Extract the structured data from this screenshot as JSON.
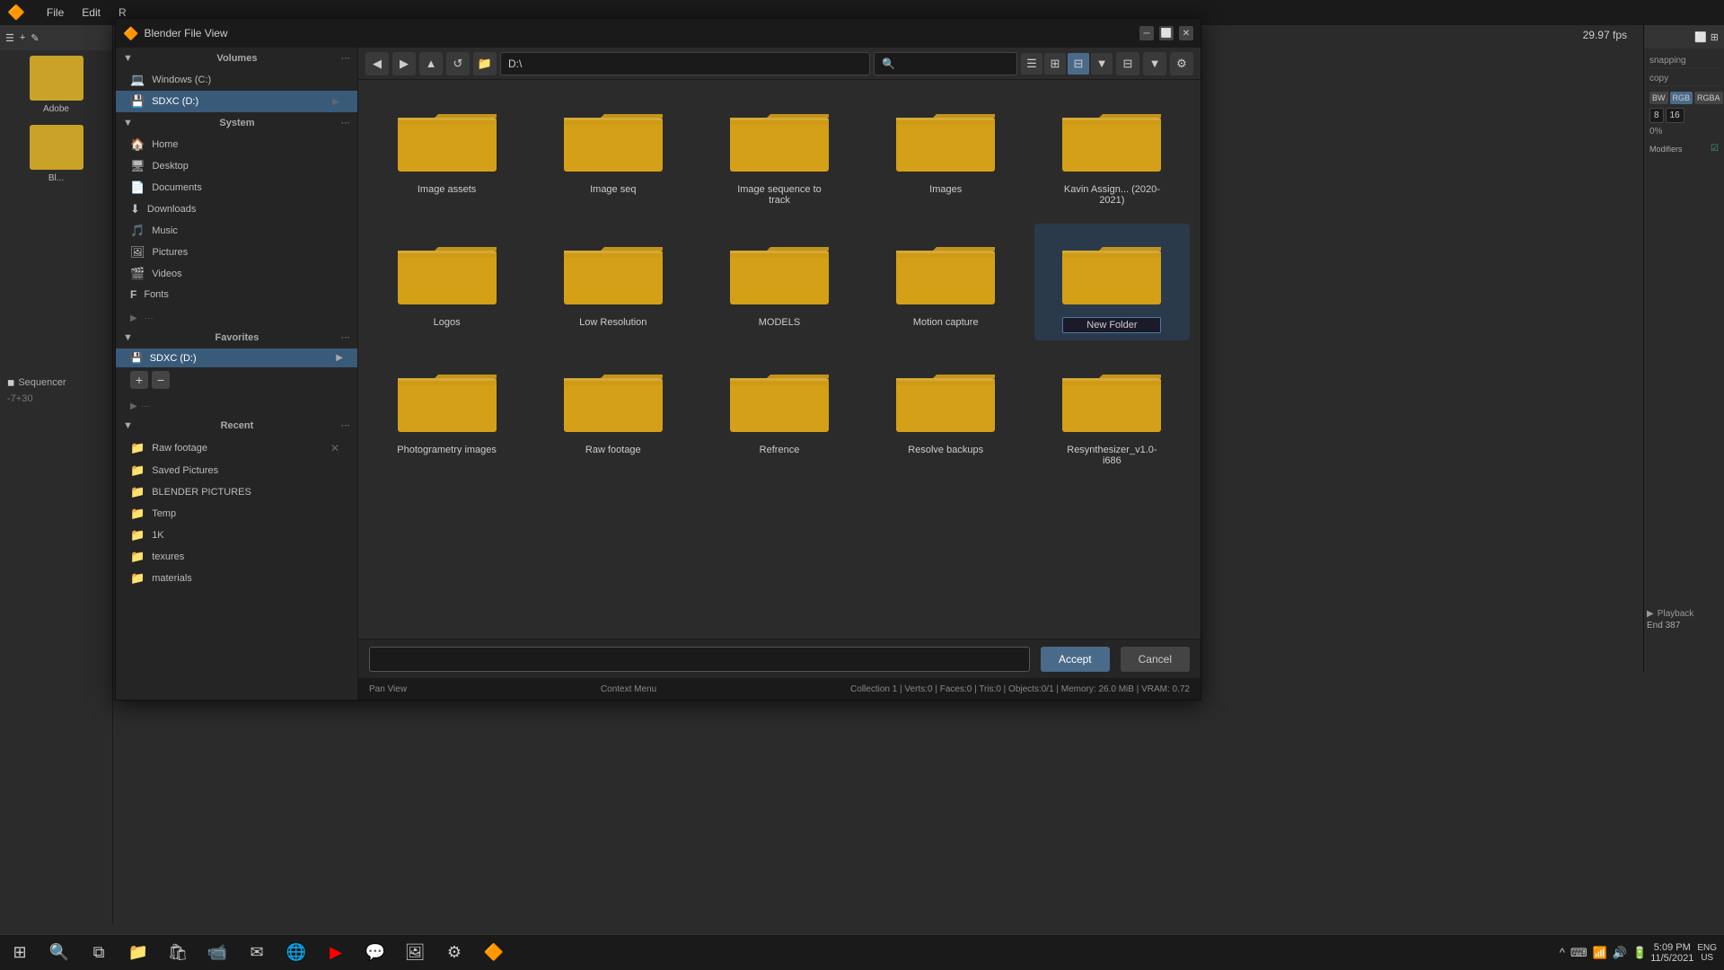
{
  "app": {
    "title": "Blender",
    "dialog_title": "Blender File View",
    "fps": "29.97 fps"
  },
  "topbar": {
    "menu_items": [
      "File",
      "Edit",
      "R",
      "Blender"
    ]
  },
  "dialog": {
    "title": "Blender File View",
    "path": "D:\\",
    "search_placeholder": "🔍"
  },
  "sidebar": {
    "volumes_label": "Volumes",
    "volumes": [
      {
        "label": "Windows (C:)",
        "icon": "💻",
        "active": false
      },
      {
        "label": "SDXC (D:)",
        "icon": "💾",
        "active": true
      }
    ],
    "system_label": "System",
    "system_items": [
      {
        "label": "Home",
        "icon": "🏠"
      },
      {
        "label": "Desktop",
        "icon": "🖥"
      },
      {
        "label": "Documents",
        "icon": "📄"
      },
      {
        "label": "Downloads",
        "icon": "⬇"
      },
      {
        "label": "Music",
        "icon": "🎵"
      },
      {
        "label": "Pictures",
        "icon": "🖼"
      },
      {
        "label": "Videos",
        "icon": "🎬"
      },
      {
        "label": "Fonts",
        "icon": "F"
      }
    ],
    "favorites_label": "Favorites",
    "favorites": [
      {
        "label": "SDXC (D:)",
        "icon": "💾",
        "active": true
      }
    ],
    "recent_label": "Recent",
    "recent_items": [
      {
        "label": "Raw footage"
      },
      {
        "label": "Saved Pictures"
      },
      {
        "label": "BLENDER PICTURES"
      },
      {
        "label": "Temp"
      },
      {
        "label": "1K"
      },
      {
        "label": "texures"
      },
      {
        "label": "materials"
      }
    ]
  },
  "files": [
    {
      "name": "Image assets",
      "type": "folder",
      "editing": false
    },
    {
      "name": "Image seq",
      "type": "folder",
      "editing": false
    },
    {
      "name": "Image sequence to track",
      "type": "folder",
      "editing": false
    },
    {
      "name": "Images",
      "type": "folder",
      "editing": false
    },
    {
      "name": "Kavin Assign... (2020-2021)",
      "type": "folder",
      "editing": false
    },
    {
      "name": "Logos",
      "type": "folder",
      "editing": false
    },
    {
      "name": "Low Resolution",
      "type": "folder",
      "editing": false
    },
    {
      "name": "MODELS",
      "type": "folder",
      "editing": false
    },
    {
      "name": "Motion capture",
      "type": "folder",
      "editing": false
    },
    {
      "name": "New Folder",
      "type": "folder",
      "editing": true
    },
    {
      "name": "Photogrametry images",
      "type": "folder",
      "editing": false
    },
    {
      "name": "Raw footage",
      "type": "folder",
      "editing": false
    },
    {
      "name": "Refrence",
      "type": "folder",
      "editing": false
    },
    {
      "name": "Resolve backups",
      "type": "folder",
      "editing": false
    },
    {
      "name": "Resynthesizer_v1.0-i686",
      "type": "folder",
      "editing": false
    }
  ],
  "bottom": {
    "filename_placeholder": "",
    "accept_label": "Accept",
    "cancel_label": "Cancel"
  },
  "status": {
    "pan_view": "Pan View",
    "context_menu": "Context Menu",
    "stats": "Collection 1 | Verts:0 | Faces:0 | Tris:0 | Objects:0/1 | Memory: 26.0 MiB | VRAM: 0.72"
  },
  "taskbar": {
    "time": "5:09 PM",
    "date": "11/5/2021",
    "locale": "ENG\nUS"
  },
  "right_panel": {
    "label": "snapping",
    "copy_label": "copy",
    "bw": "BW",
    "rgb": "RGB",
    "rgba": "RGBA",
    "val8": "8",
    "val16": "16",
    "percent": "0%",
    "end": "387",
    "frame_minus7plus30": "-7+30",
    "modifiers_label": "Modifiers"
  }
}
